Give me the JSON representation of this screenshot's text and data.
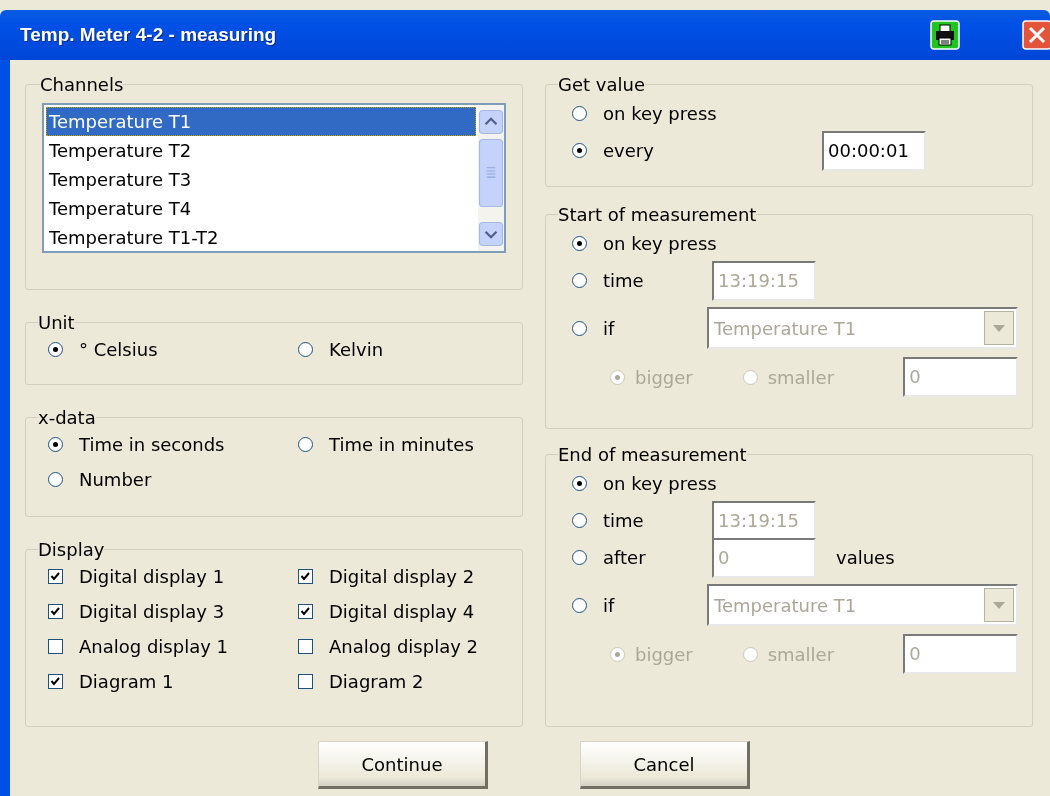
{
  "window": {
    "title": "Temp. Meter 4-2 - measuring"
  },
  "channels": {
    "label": "Channels",
    "items": [
      {
        "label": "Temperature T1",
        "selected": true
      },
      {
        "label": "Temperature T2",
        "selected": false
      },
      {
        "label": "Temperature T3",
        "selected": false
      },
      {
        "label": "Temperature T4",
        "selected": false
      },
      {
        "label": "Temperature T1-T2",
        "selected": false
      }
    ]
  },
  "unit": {
    "label": "Unit",
    "options": [
      {
        "label": "° Celsius",
        "selected": true
      },
      {
        "label": "Kelvin",
        "selected": false
      }
    ]
  },
  "x_data": {
    "label": "x-data",
    "options": [
      {
        "label": "Time in seconds",
        "selected": true
      },
      {
        "label": "Time in minutes",
        "selected": false
      },
      {
        "label": "Number",
        "selected": false
      }
    ]
  },
  "display": {
    "label": "Display",
    "checkboxes": [
      {
        "label": "Digital display 1",
        "checked": true
      },
      {
        "label": "Digital display 2",
        "checked": true
      },
      {
        "label": "Digital display 3",
        "checked": true
      },
      {
        "label": "Digital display 4",
        "checked": true
      },
      {
        "label": "Analog display 1",
        "checked": false
      },
      {
        "label": "Analog display 2",
        "checked": false
      },
      {
        "label": "Diagram 1",
        "checked": true
      },
      {
        "label": "Diagram 2",
        "checked": false
      }
    ]
  },
  "get_value": {
    "label": "Get value",
    "options": [
      {
        "label": "on key press",
        "selected": false
      },
      {
        "label": "every",
        "selected": true,
        "field": {
          "value": "00:00:01",
          "disabled": false
        }
      }
    ]
  },
  "start": {
    "label": "Start of measurement",
    "options": [
      {
        "label": "on key press",
        "selected": true
      },
      {
        "label": "time",
        "selected": false,
        "field": {
          "value": "13:19:15",
          "disabled": true
        }
      },
      {
        "label": "if",
        "selected": false,
        "dropdown": {
          "value": "Temperature T1",
          "disabled": true
        }
      }
    ],
    "comparison": {
      "disabled": true,
      "options": [
        {
          "label": "bigger",
          "selected": true
        },
        {
          "label": "smaller",
          "selected": false
        }
      ],
      "threshold": {
        "value": "0",
        "disabled": true
      }
    }
  },
  "end": {
    "label": "End of measurement",
    "options": [
      {
        "label": "on key press",
        "selected": true
      },
      {
        "label": "time",
        "selected": false,
        "field": {
          "value": "13:19:15",
          "disabled": true
        }
      },
      {
        "label": "after",
        "selected": false,
        "field": {
          "value": "0",
          "disabled": true
        },
        "suffix": "values"
      },
      {
        "label": "if",
        "selected": false,
        "dropdown": {
          "value": "Temperature T1",
          "disabled": true
        }
      }
    ],
    "comparison": {
      "disabled": true,
      "options": [
        {
          "label": "bigger",
          "selected": true
        },
        {
          "label": "smaller",
          "selected": false
        }
      ],
      "threshold": {
        "value": "0",
        "disabled": true
      }
    }
  },
  "buttons": [
    {
      "label": "Continue"
    },
    {
      "label": "Cancel"
    }
  ]
}
